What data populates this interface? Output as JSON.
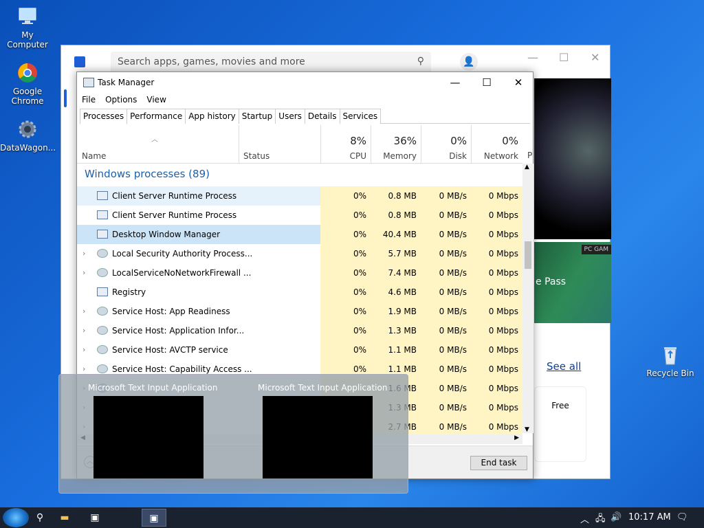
{
  "desktop": {
    "icons": [
      {
        "label": "My Computer"
      },
      {
        "label": "Google Chrome"
      },
      {
        "label": "DataWagon..."
      },
      {
        "label": "Recycle Bin"
      }
    ]
  },
  "store": {
    "search_placeholder": "Search apps, games, movies and more",
    "hero_text": "e Pass",
    "badge": "PC GAM",
    "see_all": "See all",
    "card_price": "Free"
  },
  "task_manager": {
    "title": "Task Manager",
    "menu": [
      "File",
      "Options",
      "View"
    ],
    "tabs": [
      "Processes",
      "Performance",
      "App history",
      "Startup",
      "Users",
      "Details",
      "Services"
    ],
    "columns": {
      "name": "Name",
      "status": "Status",
      "cpu": {
        "pct": "8%",
        "label": "CPU"
      },
      "memory": {
        "pct": "36%",
        "label": "Memory"
      },
      "disk": {
        "pct": "0%",
        "label": "Disk"
      },
      "network": {
        "pct": "0%",
        "label": "Network"
      },
      "extra": "P"
    },
    "group": "Windows processes (89)",
    "rows": [
      {
        "name": "Client Server Runtime Process",
        "cpu": "0%",
        "mem": "0.8 MB",
        "disk": "0 MB/s",
        "net": "0 Mbps"
      },
      {
        "name": "Client Server Runtime Process",
        "cpu": "0%",
        "mem": "0.8 MB",
        "disk": "0 MB/s",
        "net": "0 Mbps"
      },
      {
        "name": "Desktop Window Manager",
        "cpu": "0%",
        "mem": "40.4 MB",
        "disk": "0 MB/s",
        "net": "0 Mbps"
      },
      {
        "name": "Local Security Authority Process...",
        "cpu": "0%",
        "mem": "5.7 MB",
        "disk": "0 MB/s",
        "net": "0 Mbps"
      },
      {
        "name": "LocalServiceNoNetworkFirewall ...",
        "cpu": "0%",
        "mem": "7.4 MB",
        "disk": "0 MB/s",
        "net": "0 Mbps"
      },
      {
        "name": "Registry",
        "cpu": "0%",
        "mem": "4.6 MB",
        "disk": "0 MB/s",
        "net": "0 Mbps"
      },
      {
        "name": "Service Host: App Readiness",
        "cpu": "0%",
        "mem": "1.9 MB",
        "disk": "0 MB/s",
        "net": "0 Mbps"
      },
      {
        "name": "Service Host: Application Infor...",
        "cpu": "0%",
        "mem": "1.3 MB",
        "disk": "0 MB/s",
        "net": "0 Mbps"
      },
      {
        "name": "Service Host: AVCTP service",
        "cpu": "0%",
        "mem": "1.1 MB",
        "disk": "0 MB/s",
        "net": "0 Mbps"
      },
      {
        "name": "Service Host: Capability Access ...",
        "cpu": "0%",
        "mem": "1.1 MB",
        "disk": "0 MB/s",
        "net": "0 Mbps"
      },
      {
        "name": "",
        "cpu": "",
        "mem": "1.6 MB",
        "disk": "0 MB/s",
        "net": "0 Mbps"
      },
      {
        "name": "",
        "cpu": "",
        "mem": "1.3 MB",
        "disk": "0 MB/s",
        "net": "0 Mbps"
      },
      {
        "name": "",
        "cpu": "",
        "mem": "2.7 MB",
        "disk": "0 MB/s",
        "net": "0 Mbps"
      }
    ],
    "end_task": "End task"
  },
  "peek": {
    "titles": [
      "Microsoft Text Input Application",
      "Microsoft Text Input Application"
    ]
  },
  "taskbar": {
    "clock": "10:17 AM"
  }
}
